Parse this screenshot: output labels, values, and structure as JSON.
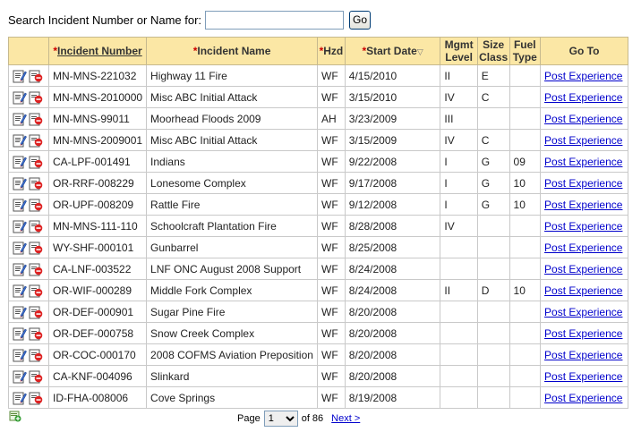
{
  "search": {
    "label": "Search Incident Number or Name for:",
    "value": "",
    "placeholder": "",
    "go_label": "Go"
  },
  "columns": {
    "incident_number": "Incident Number",
    "incident_name": "Incident Name",
    "hzd": "Hzd",
    "start_date": "Start Date",
    "mgmt_level_1": "Mgmt",
    "mgmt_level_2": "Level",
    "size_class_1": "Size",
    "size_class_2": "Class",
    "fuel_type_1": "Fuel",
    "fuel_type_2": "Type",
    "go_to": "Go To",
    "required_marker": "*",
    "sort_indicator": "▽"
  },
  "rows": [
    {
      "number": "MN-MNS-221032",
      "name": "Highway 11 Fire",
      "hzd": "WF",
      "date": "4/15/2010",
      "mgmt": "II",
      "size": "E",
      "fuel": "",
      "link": "Post Experience"
    },
    {
      "number": "MN-MNS-2010000",
      "name": "Misc ABC Initial Attack",
      "hzd": "WF",
      "date": "3/15/2010",
      "mgmt": "IV",
      "size": "C",
      "fuel": "",
      "link": "Post Experience"
    },
    {
      "number": "MN-MNS-99011",
      "name": "Moorhead Floods 2009",
      "hzd": "AH",
      "date": "3/23/2009",
      "mgmt": "III",
      "size": "",
      "fuel": "",
      "link": "Post Experience"
    },
    {
      "number": "MN-MNS-2009001",
      "name": "Misc ABC Initial Attack",
      "hzd": "WF",
      "date": "3/15/2009",
      "mgmt": "IV",
      "size": "C",
      "fuel": "",
      "link": "Post Experience"
    },
    {
      "number": "CA-LPF-001491",
      "name": "Indians",
      "hzd": "WF",
      "date": "9/22/2008",
      "mgmt": "I",
      "size": "G",
      "fuel": "09",
      "link": "Post Experience"
    },
    {
      "number": "OR-RRF-008229",
      "name": "Lonesome Complex",
      "hzd": "WF",
      "date": "9/17/2008",
      "mgmt": "I",
      "size": "G",
      "fuel": "10",
      "link": "Post Experience"
    },
    {
      "number": "OR-UPF-008209",
      "name": "Rattle Fire",
      "hzd": "WF",
      "date": "9/12/2008",
      "mgmt": "I",
      "size": "G",
      "fuel": "10",
      "link": "Post Experience"
    },
    {
      "number": "MN-MNS-111-110",
      "name": "Schoolcraft Plantation Fire",
      "hzd": "WF",
      "date": "8/28/2008",
      "mgmt": "IV",
      "size": "",
      "fuel": "",
      "link": "Post Experience"
    },
    {
      "number": "WY-SHF-000101",
      "name": "Gunbarrel",
      "hzd": "WF",
      "date": "8/25/2008",
      "mgmt": "",
      "size": "",
      "fuel": "",
      "link": "Post Experience"
    },
    {
      "number": "CA-LNF-003522",
      "name": "LNF ONC August 2008 Support",
      "hzd": "WF",
      "date": "8/24/2008",
      "mgmt": "",
      "size": "",
      "fuel": "",
      "link": "Post Experience"
    },
    {
      "number": "OR-WIF-000289",
      "name": "Middle Fork Complex",
      "hzd": "WF",
      "date": "8/24/2008",
      "mgmt": "II",
      "size": "D",
      "fuel": "10",
      "link": "Post Experience"
    },
    {
      "number": "OR-DEF-000901",
      "name": "Sugar Pine Fire",
      "hzd": "WF",
      "date": "8/20/2008",
      "mgmt": "",
      "size": "",
      "fuel": "",
      "link": "Post Experience"
    },
    {
      "number": "OR-DEF-000758",
      "name": "Snow Creek Complex",
      "hzd": "WF",
      "date": "8/20/2008",
      "mgmt": "",
      "size": "",
      "fuel": "",
      "link": "Post Experience"
    },
    {
      "number": "OR-COC-000170",
      "name": "2008 COFMS Aviation Preposition",
      "hzd": "WF",
      "date": "8/20/2008",
      "mgmt": "",
      "size": "",
      "fuel": "",
      "link": "Post Experience"
    },
    {
      "number": "CA-KNF-004096",
      "name": "Slinkard",
      "hzd": "WF",
      "date": "8/20/2008",
      "mgmt": "",
      "size": "",
      "fuel": "",
      "link": "Post Experience"
    },
    {
      "number": "ID-FHA-008006",
      "name": "Cove Springs",
      "hzd": "WF",
      "date": "8/19/2008",
      "mgmt": "",
      "size": "",
      "fuel": "",
      "link": "Post Experience"
    }
  ],
  "pager": {
    "page_label": "Page",
    "current_page": "1",
    "of_label": "of 86",
    "next_label": "Next >"
  },
  "icons": {
    "edit": "edit-icon",
    "delete": "delete-icon",
    "add": "add-icon"
  },
  "colors": {
    "header_bg": "#fbe7a5",
    "required": "#cc0000",
    "link": "#0000cc"
  }
}
